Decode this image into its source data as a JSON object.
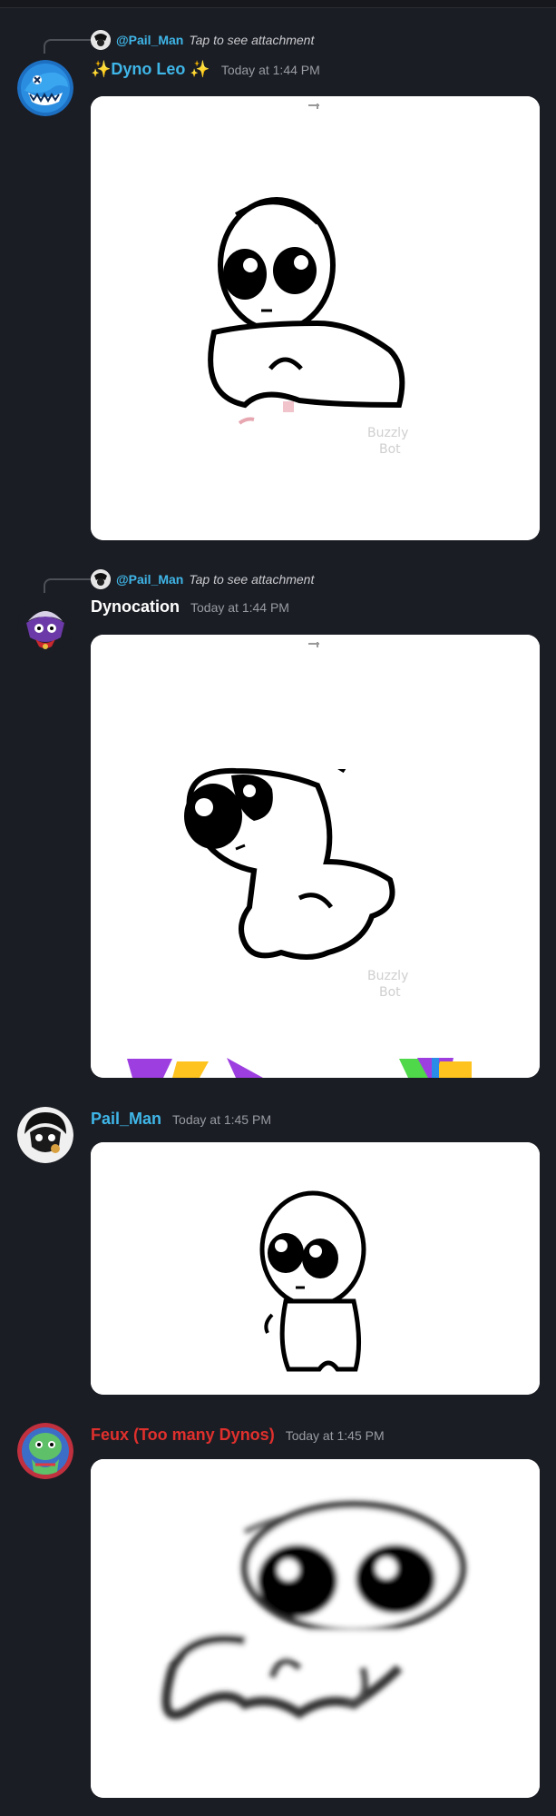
{
  "messages": [
    {
      "reply": {
        "username": "@Pail_Man",
        "text": "Tap to see attachment"
      },
      "author": "✨Dyno Leo ✨",
      "author_color": "#3fb6e8",
      "timestamp": "Today at 1:44 PM",
      "avatar_icon": "shark-avatar",
      "attachment_icon": "cartoon-creature-image"
    },
    {
      "reply": {
        "username": "@Pail_Man",
        "text": "Tap to see attachment"
      },
      "author": "Dynocation",
      "author_color": "#ffffff",
      "timestamp": "Today at 1:44 PM",
      "avatar_icon": "purple-character-avatar",
      "attachment_icon": "cartoon-creature-image"
    },
    {
      "author": "Pail_Man",
      "author_color": "#3fb6e8",
      "timestamp": "Today at 1:45 PM",
      "avatar_icon": "monochrome-character-avatar",
      "attachment_icon": "cartoon-creature-image"
    },
    {
      "author": "Feux (Too many Dynos)",
      "author_color": "#e0302d",
      "timestamp": "Today at 1:45 PM",
      "avatar_icon": "green-character-avatar",
      "attachment_icon": "blurry-cartoon-creature-image"
    }
  ]
}
